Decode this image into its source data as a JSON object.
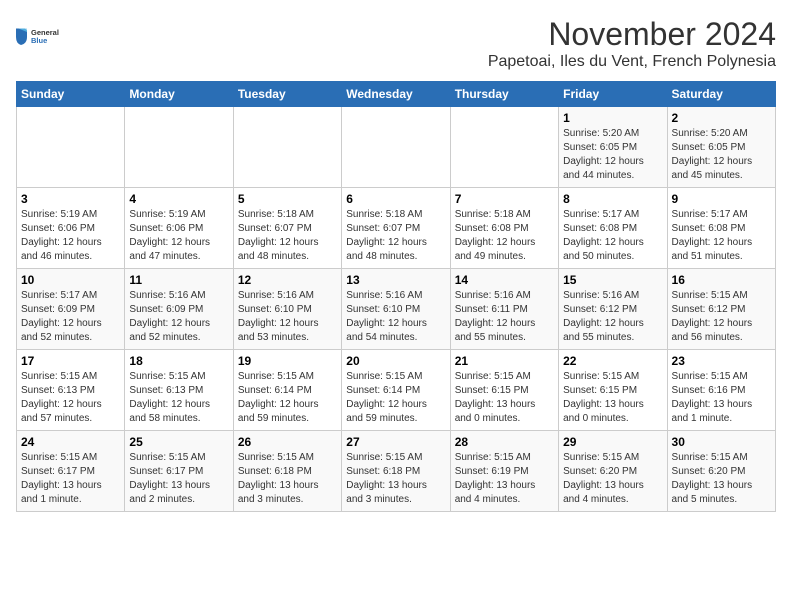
{
  "logo": {
    "general": "General",
    "blue": "Blue"
  },
  "title": "November 2024",
  "subtitle": "Papetoai, Iles du Vent, French Polynesia",
  "days_header": [
    "Sunday",
    "Monday",
    "Tuesday",
    "Wednesday",
    "Thursday",
    "Friday",
    "Saturday"
  ],
  "weeks": [
    [
      {
        "day": "",
        "info": ""
      },
      {
        "day": "",
        "info": ""
      },
      {
        "day": "",
        "info": ""
      },
      {
        "day": "",
        "info": ""
      },
      {
        "day": "",
        "info": ""
      },
      {
        "day": "1",
        "info": "Sunrise: 5:20 AM\nSunset: 6:05 PM\nDaylight: 12 hours\nand 44 minutes."
      },
      {
        "day": "2",
        "info": "Sunrise: 5:20 AM\nSunset: 6:05 PM\nDaylight: 12 hours\nand 45 minutes."
      }
    ],
    [
      {
        "day": "3",
        "info": "Sunrise: 5:19 AM\nSunset: 6:06 PM\nDaylight: 12 hours\nand 46 minutes."
      },
      {
        "day": "4",
        "info": "Sunrise: 5:19 AM\nSunset: 6:06 PM\nDaylight: 12 hours\nand 47 minutes."
      },
      {
        "day": "5",
        "info": "Sunrise: 5:18 AM\nSunset: 6:07 PM\nDaylight: 12 hours\nand 48 minutes."
      },
      {
        "day": "6",
        "info": "Sunrise: 5:18 AM\nSunset: 6:07 PM\nDaylight: 12 hours\nand 48 minutes."
      },
      {
        "day": "7",
        "info": "Sunrise: 5:18 AM\nSunset: 6:08 PM\nDaylight: 12 hours\nand 49 minutes."
      },
      {
        "day": "8",
        "info": "Sunrise: 5:17 AM\nSunset: 6:08 PM\nDaylight: 12 hours\nand 50 minutes."
      },
      {
        "day": "9",
        "info": "Sunrise: 5:17 AM\nSunset: 6:08 PM\nDaylight: 12 hours\nand 51 minutes."
      }
    ],
    [
      {
        "day": "10",
        "info": "Sunrise: 5:17 AM\nSunset: 6:09 PM\nDaylight: 12 hours\nand 52 minutes."
      },
      {
        "day": "11",
        "info": "Sunrise: 5:16 AM\nSunset: 6:09 PM\nDaylight: 12 hours\nand 52 minutes."
      },
      {
        "day": "12",
        "info": "Sunrise: 5:16 AM\nSunset: 6:10 PM\nDaylight: 12 hours\nand 53 minutes."
      },
      {
        "day": "13",
        "info": "Sunrise: 5:16 AM\nSunset: 6:10 PM\nDaylight: 12 hours\nand 54 minutes."
      },
      {
        "day": "14",
        "info": "Sunrise: 5:16 AM\nSunset: 6:11 PM\nDaylight: 12 hours\nand 55 minutes."
      },
      {
        "day": "15",
        "info": "Sunrise: 5:16 AM\nSunset: 6:12 PM\nDaylight: 12 hours\nand 55 minutes."
      },
      {
        "day": "16",
        "info": "Sunrise: 5:15 AM\nSunset: 6:12 PM\nDaylight: 12 hours\nand 56 minutes."
      }
    ],
    [
      {
        "day": "17",
        "info": "Sunrise: 5:15 AM\nSunset: 6:13 PM\nDaylight: 12 hours\nand 57 minutes."
      },
      {
        "day": "18",
        "info": "Sunrise: 5:15 AM\nSunset: 6:13 PM\nDaylight: 12 hours\nand 58 minutes."
      },
      {
        "day": "19",
        "info": "Sunrise: 5:15 AM\nSunset: 6:14 PM\nDaylight: 12 hours\nand 59 minutes."
      },
      {
        "day": "20",
        "info": "Sunrise: 5:15 AM\nSunset: 6:14 PM\nDaylight: 12 hours\nand 59 minutes."
      },
      {
        "day": "21",
        "info": "Sunrise: 5:15 AM\nSunset: 6:15 PM\nDaylight: 13 hours\nand 0 minutes."
      },
      {
        "day": "22",
        "info": "Sunrise: 5:15 AM\nSunset: 6:15 PM\nDaylight: 13 hours\nand 0 minutes."
      },
      {
        "day": "23",
        "info": "Sunrise: 5:15 AM\nSunset: 6:16 PM\nDaylight: 13 hours\nand 1 minute."
      }
    ],
    [
      {
        "day": "24",
        "info": "Sunrise: 5:15 AM\nSunset: 6:17 PM\nDaylight: 13 hours\nand 1 minute."
      },
      {
        "day": "25",
        "info": "Sunrise: 5:15 AM\nSunset: 6:17 PM\nDaylight: 13 hours\nand 2 minutes."
      },
      {
        "day": "26",
        "info": "Sunrise: 5:15 AM\nSunset: 6:18 PM\nDaylight: 13 hours\nand 3 minutes."
      },
      {
        "day": "27",
        "info": "Sunrise: 5:15 AM\nSunset: 6:18 PM\nDaylight: 13 hours\nand 3 minutes."
      },
      {
        "day": "28",
        "info": "Sunrise: 5:15 AM\nSunset: 6:19 PM\nDaylight: 13 hours\nand 4 minutes."
      },
      {
        "day": "29",
        "info": "Sunrise: 5:15 AM\nSunset: 6:20 PM\nDaylight: 13 hours\nand 4 minutes."
      },
      {
        "day": "30",
        "info": "Sunrise: 5:15 AM\nSunset: 6:20 PM\nDaylight: 13 hours\nand 5 minutes."
      }
    ]
  ]
}
